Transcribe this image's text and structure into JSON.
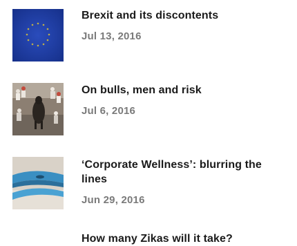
{
  "articles": [
    {
      "title": "Brexit and its discontents",
      "date": "Jul 13, 2016",
      "thumbnail": "eu-flag-image"
    },
    {
      "title": "On bulls, men and risk",
      "date": "Jul 6, 2016",
      "thumbnail": "bull-run-image"
    },
    {
      "title": "‘Corporate Wellness’: blurring the lines",
      "date": "Jun 29, 2016",
      "thumbnail": "fitness-tracker-image"
    },
    {
      "title": "How many Zikas will it take?",
      "date": "",
      "thumbnail": ""
    }
  ],
  "colors": {
    "title": "#1a1a1a",
    "date": "#7a7a7a",
    "eu_blue": "#1f3fa8",
    "eu_star": "#d9c13a"
  }
}
